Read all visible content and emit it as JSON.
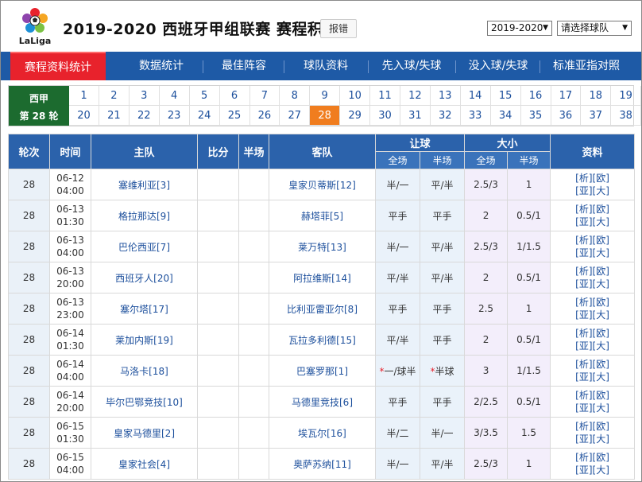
{
  "header": {
    "logo_text": "LaLiga",
    "title": "2019-2020 西班牙甲组联赛 赛程积分",
    "report_label": "报错",
    "season_value": "2019-2020",
    "team_placeholder": "请选择球队"
  },
  "nav": {
    "items": [
      "赛程资料统计",
      "数据统计",
      "最佳阵容",
      "球队资料",
      "先入球/失球",
      "没入球/失球",
      "标准亚指对照"
    ]
  },
  "rounds": {
    "league": "西甲",
    "current_label": "第 28 轮",
    "current": "28",
    "row1": [
      "1",
      "2",
      "3",
      "4",
      "5",
      "6",
      "7",
      "8",
      "9",
      "10",
      "11",
      "12",
      "13",
      "14",
      "15",
      "16",
      "17",
      "18",
      "19"
    ],
    "row2": [
      "20",
      "21",
      "22",
      "23",
      "24",
      "25",
      "26",
      "27",
      "28",
      "29",
      "30",
      "31",
      "32",
      "33",
      "34",
      "35",
      "36",
      "37",
      "38"
    ]
  },
  "table": {
    "headers": {
      "round": "轮次",
      "time": "时间",
      "home": "主队",
      "score": "比分",
      "half": "半场",
      "away": "客队",
      "handicap": "让球",
      "overunder": "大小",
      "info": "资料",
      "full": "全场",
      "halfsub": "半场"
    },
    "rows": [
      {
        "round": "28",
        "date": "06-12",
        "time": "04:00",
        "home": "塞维利亚[3]",
        "score": "",
        "half": "",
        "away": "皇家贝蒂斯[12]",
        "h_full": "半/一",
        "h_half": "平/半",
        "h_full_star": false,
        "h_half_star": false,
        "o_full": "2.5/3",
        "o_half": "1",
        "links1": "[析][欧]",
        "links2": "[亚][大]"
      },
      {
        "round": "28",
        "date": "06-13",
        "time": "01:30",
        "home": "格拉那达[9]",
        "score": "",
        "half": "",
        "away": "赫塔菲[5]",
        "h_full": "平手",
        "h_half": "平手",
        "h_full_star": false,
        "h_half_star": false,
        "o_full": "2",
        "o_half": "0.5/1",
        "links1": "[析][欧]",
        "links2": "[亚][大]"
      },
      {
        "round": "28",
        "date": "06-13",
        "time": "04:00",
        "home": "巴伦西亚[7]",
        "score": "",
        "half": "",
        "away": "莱万特[13]",
        "h_full": "半/一",
        "h_half": "平/半",
        "h_full_star": false,
        "h_half_star": false,
        "o_full": "2.5/3",
        "o_half": "1/1.5",
        "links1": "[析][欧]",
        "links2": "[亚][大]"
      },
      {
        "round": "28",
        "date": "06-13",
        "time": "20:00",
        "home": "西班牙人[20]",
        "score": "",
        "half": "",
        "away": "阿拉维斯[14]",
        "h_full": "平/半",
        "h_half": "平/半",
        "h_full_star": false,
        "h_half_star": false,
        "o_full": "2",
        "o_half": "0.5/1",
        "links1": "[析][欧]",
        "links2": "[亚][大]"
      },
      {
        "round": "28",
        "date": "06-13",
        "time": "23:00",
        "home": "塞尔塔[17]",
        "score": "",
        "half": "",
        "away": "比利亚雷亚尔[8]",
        "h_full": "平手",
        "h_half": "平手",
        "h_full_star": false,
        "h_half_star": false,
        "o_full": "2.5",
        "o_half": "1",
        "links1": "[析][欧]",
        "links2": "[亚][大]"
      },
      {
        "round": "28",
        "date": "06-14",
        "time": "01:30",
        "home": "莱加内斯[19]",
        "score": "",
        "half": "",
        "away": "瓦拉多利德[15]",
        "h_full": "平/半",
        "h_half": "平手",
        "h_full_star": false,
        "h_half_star": false,
        "o_full": "2",
        "o_half": "0.5/1",
        "links1": "[析][欧]",
        "links2": "[亚][大]"
      },
      {
        "round": "28",
        "date": "06-14",
        "time": "04:00",
        "home": "马洛卡[18]",
        "score": "",
        "half": "",
        "away": "巴塞罗那[1]",
        "h_full": "一/球半",
        "h_half": "半球",
        "h_full_star": true,
        "h_half_star": true,
        "o_full": "3",
        "o_half": "1/1.5",
        "links1": "[析][欧]",
        "links2": "[亚][大]"
      },
      {
        "round": "28",
        "date": "06-14",
        "time": "20:00",
        "home": "毕尔巴鄂竞技[10]",
        "score": "",
        "half": "",
        "away": "马德里竞技[6]",
        "h_full": "平手",
        "h_half": "平手",
        "h_full_star": false,
        "h_half_star": false,
        "o_full": "2/2.5",
        "o_half": "0.5/1",
        "links1": "[析][欧]",
        "links2": "[亚][大]"
      },
      {
        "round": "28",
        "date": "06-15",
        "time": "01:30",
        "home": "皇家马德里[2]",
        "score": "",
        "half": "",
        "away": "埃瓦尔[16]",
        "h_full": "半/二",
        "h_half": "半/一",
        "h_full_star": false,
        "h_half_star": false,
        "o_full": "3/3.5",
        "o_half": "1.5",
        "links1": "[析][欧]",
        "links2": "[亚][大]"
      },
      {
        "round": "28",
        "date": "06-15",
        "time": "04:00",
        "home": "皇家社会[4]",
        "score": "",
        "half": "",
        "away": "奥萨苏纳[11]",
        "h_full": "半/一",
        "h_half": "平/半",
        "h_full_star": false,
        "h_half_star": false,
        "o_full": "2.5/3",
        "o_half": "1",
        "links1": "[析][欧]",
        "links2": "[亚][大]"
      }
    ]
  }
}
